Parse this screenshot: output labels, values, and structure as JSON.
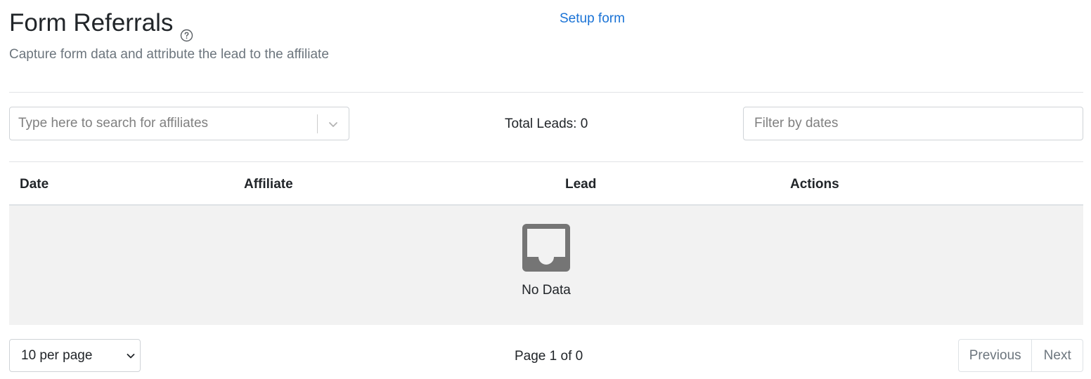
{
  "header": {
    "title": "Form Referrals",
    "help_icon": "question-circle-icon",
    "setup_link": "Setup form",
    "subtitle": "Capture form data and attribute the lead to the affiliate"
  },
  "filters": {
    "affiliate_search_placeholder": "Type here to search for affiliates",
    "affiliate_dropdown_icon": "chevron-down-icon",
    "total_leads": "Total Leads: 0",
    "date_filter_placeholder": "Filter by dates"
  },
  "table": {
    "columns": [
      "Date",
      "Affiliate",
      "Lead",
      "Actions"
    ],
    "rows": [],
    "empty_icon": "inbox-icon",
    "empty_text": "No Data"
  },
  "pagination": {
    "per_page_selected": "10 per page",
    "page_info": "Page 1 of 0",
    "previous_label": "Previous",
    "next_label": "Next"
  },
  "colors": {
    "link": "#1a73d6",
    "muted_text": "#6c757d",
    "empty_bg": "#f2f2f2",
    "icon_gray": "#757575"
  }
}
